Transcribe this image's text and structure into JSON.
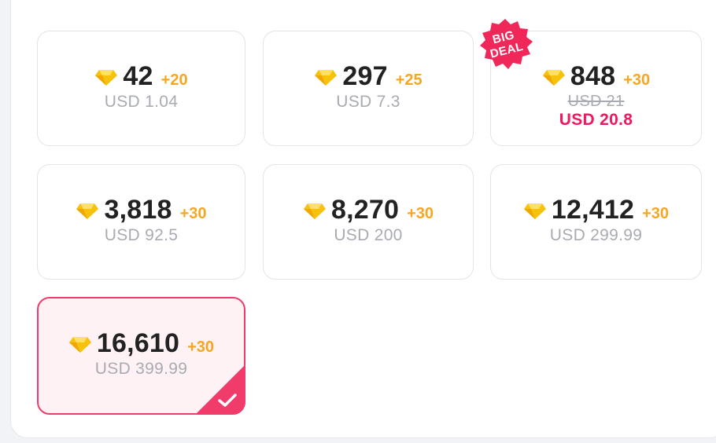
{
  "packages": [
    {
      "amount": "42",
      "bonus": "+20",
      "price": "USD 1.04"
    },
    {
      "amount": "297",
      "bonus": "+25",
      "price": "USD 7.3"
    },
    {
      "amount": "848",
      "bonus": "+30",
      "original_price": "USD 21",
      "price": "USD 20.8",
      "badge": [
        "BIG",
        "DEAL"
      ]
    },
    {
      "amount": "3,818",
      "bonus": "+30",
      "price": "USD 92.5"
    },
    {
      "amount": "8,270",
      "bonus": "+30",
      "price": "USD 200"
    },
    {
      "amount": "12,412",
      "bonus": "+30",
      "price": "USD 299.99"
    },
    {
      "amount": "16,610",
      "bonus": "+30",
      "price": "USD 399.99",
      "selected": true
    }
  ],
  "colors": {
    "gem": "#f7c20c",
    "bonus": "#f5a623",
    "accent": "#f13c6b",
    "sale_price": "#f0195f",
    "badge": "#f0285a"
  },
  "icons": {
    "currency": "diamond-icon",
    "selected": "checkmark-icon"
  }
}
